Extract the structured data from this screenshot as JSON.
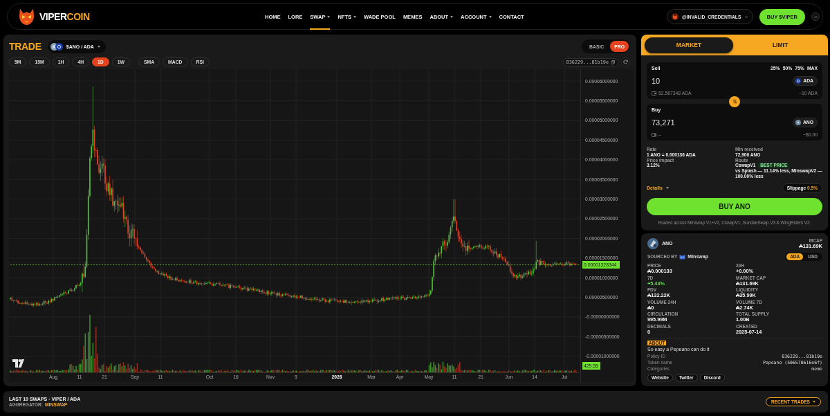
{
  "nav": {
    "brand_main": "VIPER",
    "brand_accent": "COIN",
    "links": [
      {
        "label": "HOME",
        "has_menu": false,
        "selected": false
      },
      {
        "label": "LORE",
        "has_menu": false,
        "selected": false
      },
      {
        "label": "SWAP",
        "has_menu": true,
        "selected": true
      },
      {
        "label": "NFTS",
        "has_menu": true,
        "selected": false
      },
      {
        "label": "WADE POOL",
        "has_menu": false,
        "selected": false
      },
      {
        "label": "MEMES",
        "has_menu": false,
        "selected": false
      },
      {
        "label": "ABOUT",
        "has_menu": true,
        "selected": false
      },
      {
        "label": "ACCOUNT",
        "has_menu": true,
        "selected": false
      },
      {
        "label": "CONTACT",
        "has_menu": false,
        "selected": false
      }
    ],
    "wallet": "@INVALID_CREDENTIALS",
    "buy_button": "BUY $VIPER"
  },
  "trade": {
    "title": "TRADE",
    "pair": "$ANO / ADA",
    "modes": [
      {
        "label": "BASIC",
        "selected": false
      },
      {
        "label": "PRO",
        "selected": true
      }
    ],
    "intervals": [
      {
        "label": "5M",
        "selected": false
      },
      {
        "label": "15M",
        "selected": false
      },
      {
        "label": "1H",
        "selected": false
      },
      {
        "label": "4H",
        "selected": false
      },
      {
        "label": "1D",
        "selected": true
      },
      {
        "label": "1W",
        "selected": false
      }
    ],
    "indicators": [
      "SMA",
      "MACD",
      "RSI"
    ],
    "address": "836229...81b19e",
    "chart": {
      "price_labels": [
        "0.00006000000",
        "0.00005500000",
        "0.00005000000",
        "0.00004500000",
        "0.00004000000",
        "0.00003500000",
        "0.00003000000",
        "0.00002500000",
        "0.00002000000",
        "0.00001500000",
        "0.00001000000",
        "0.00000500000",
        "-0.00000000000",
        "-0.00000500000",
        "-0.00001000000"
      ],
      "time_labels": [
        {
          "label": "Aug",
          "kind": "tick"
        },
        {
          "label": "11",
          "kind": "tick"
        },
        {
          "label": "21",
          "kind": "tick"
        },
        {
          "label": "Sep",
          "kind": "tick"
        },
        {
          "label": "11",
          "kind": "tick"
        },
        {
          "label": "Oct",
          "kind": "tick"
        },
        {
          "label": "16",
          "kind": "tick"
        },
        {
          "label": "Nov",
          "kind": "tick"
        },
        {
          "label": "5",
          "kind": "tick"
        },
        {
          "label": "2026",
          "kind": "year"
        },
        {
          "label": "Mar",
          "kind": "tick"
        },
        {
          "label": "Apr",
          "kind": "tick"
        },
        {
          "label": "May",
          "kind": "tick"
        },
        {
          "label": "11",
          "kind": "tick"
        },
        {
          "label": "21",
          "kind": "tick"
        },
        {
          "label": "Jun",
          "kind": "tick"
        },
        {
          "label": "14",
          "kind": "tick"
        },
        {
          "label": "Jul",
          "kind": "tick"
        }
      ],
      "last_price": "0.00001328344",
      "last_volume": "429.55"
    }
  },
  "swap": {
    "tabs": [
      {
        "label": "MARKET",
        "selected": true
      },
      {
        "label": "LIMIT",
        "selected": false
      }
    ],
    "sell": {
      "label": "Sell",
      "presets": [
        "25%",
        "50%",
        "75%",
        "MAX"
      ],
      "amount": "10",
      "token": "ADA",
      "balance": "52.567348 ADA",
      "value": "~10 ADA"
    },
    "buy": {
      "label": "Buy",
      "amount": "73,271",
      "token": "ANO",
      "balance": "–",
      "value": "~$0.00"
    },
    "quote": {
      "rate": {
        "label": "Rate",
        "value": "1 ANO = 0.000136 ADA"
      },
      "min_received": {
        "label": "Min received",
        "value": "72,906 ANO"
      },
      "price_impact": {
        "label": "Price impact",
        "value": "3.12%"
      },
      "route": {
        "label": "Route",
        "value": "CswapV1",
        "badge": "BEST PRICE",
        "note": "vs Splash — 11.14% less, MinswapV2 — 100.00% less"
      }
    },
    "details": "Details",
    "slippage": {
      "label": "Slippage",
      "value": "0.5%"
    },
    "buy_button": "BUY ANO",
    "route_note": "Routed across Minswap V1+V2, CswapV1, SundaeSwap V3 & WingRiders V2."
  },
  "token": {
    "symbol": "ANO",
    "mcap_label": "MCAP",
    "mcap": "₳131.69K",
    "source_label": "SOURCED BY",
    "source": "Minswap",
    "currencies": [
      {
        "label": "ADA",
        "selected": true
      },
      {
        "label": "USD",
        "selected": false
      }
    ],
    "stats": [
      {
        "label": "PRICE",
        "value": "₳0.000133",
        "positive": false
      },
      {
        "label": "24H",
        "value": "+0.00%",
        "positive": false
      },
      {
        "label": "7D",
        "value": "+5.43%",
        "positive": true
      },
      {
        "label": "MARKET CAP",
        "value": "₳131.69K",
        "positive": false
      },
      {
        "label": "FDV",
        "value": "₳132.22K",
        "positive": false
      },
      {
        "label": "LIQUIDITY",
        "value": "₳35.99K",
        "positive": false
      },
      {
        "label": "VOLUME 24H",
        "value": "₳0",
        "positive": false
      },
      {
        "label": "VOLUME 7D",
        "value": "₳2.74K",
        "positive": false
      },
      {
        "label": "CIRCULATION",
        "value": "995.99M",
        "positive": false
      },
      {
        "label": "TOTAL SUPPLY",
        "value": "1.00B",
        "positive": false
      },
      {
        "label": "DECIMALS",
        "value": "0",
        "positive": false
      },
      {
        "label": "CREATED",
        "value": "2025-07-14",
        "positive": false
      }
    ]
  },
  "about": {
    "title": "ABOUT",
    "text": "So easy a Pepeano can do it",
    "facts": [
      {
        "label": "Policy ID",
        "value": "836229...81b19e"
      },
      {
        "label": "Token name",
        "value": "Pepeano (506570616e6f)"
      },
      {
        "label": "Categories",
        "value": "meme"
      }
    ],
    "links": [
      "Website",
      "Twitter",
      "Discord"
    ]
  },
  "footer": {
    "title": "LAST 10 SWAPS · VIPER / ADA",
    "aggregator_label": "AGGREGATOR:",
    "aggregator": "MINSWAP",
    "button": "RECENT TRADES"
  }
}
